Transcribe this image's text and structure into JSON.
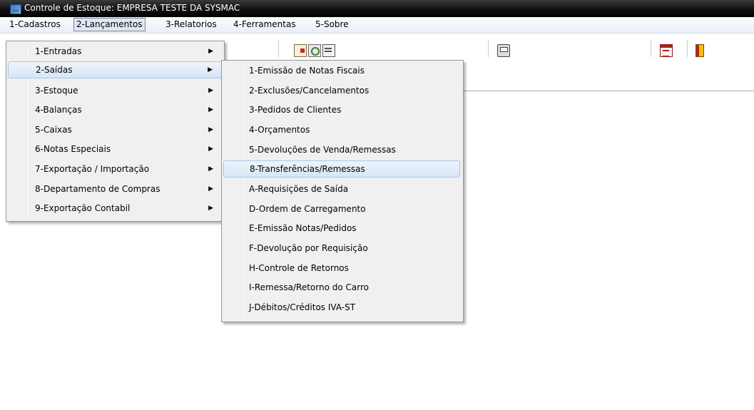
{
  "window": {
    "title": "Controle de Estoque: EMPRESA TESTE DA SYSMAC",
    "icon": "app-icon"
  },
  "menubar": {
    "items": [
      "1-Cadastros",
      "2-Lançamentos",
      "3-Relatorios",
      "4-Ferramentas",
      "5-Sobre"
    ],
    "active": "2-Lançamentos"
  },
  "toolbar": {
    "icons": [
      "document-icon",
      "find-document-icon",
      "list-document-icon",
      "printer-icon",
      "calendar-icon",
      "exit-door-icon"
    ]
  },
  "lancamentos_menu": {
    "items": [
      {
        "label": "1-Entradas",
        "submenu": true
      },
      {
        "label": "2-Saídas",
        "submenu": true
      },
      {
        "label": "3-Estoque",
        "submenu": true
      },
      {
        "label": "4-Balanças",
        "submenu": true
      },
      {
        "label": "5-Caixas",
        "submenu": true
      },
      {
        "label": "6-Notas Especiais",
        "submenu": true
      },
      {
        "label": "7-Exportação / Importação",
        "submenu": true
      },
      {
        "label": "8-Departamento de Compras",
        "submenu": true
      },
      {
        "label": "9-Exportação Contabil",
        "submenu": true
      }
    ],
    "highlighted": "2-Saídas",
    "arrow": "▶"
  },
  "saidas_menu": {
    "items": [
      "1-Emissão de Notas Fiscais",
      "2-Exclusões/Cancelamentos",
      "3-Pedidos de Clientes",
      "4-Orçamentos",
      "5-Devoluções de Venda/Remessas",
      "8-Transferências/Remessas",
      "A-Requisições de Saída",
      "D-Ordem de Carregamento",
      "E-Emissão Notas/Pedidos",
      "F-Devolução por Requisição",
      "H-Controle de Retornos",
      "I-Remessa/Retorno do Carro",
      "J-Débitos/Créditos IVA-ST"
    ],
    "highlighted": "8-Transferências/Remessas"
  },
  "colors": {
    "titlebar": "#000000",
    "menu_bg": "#f0f0f0",
    "highlight": "#d7e5f5"
  }
}
